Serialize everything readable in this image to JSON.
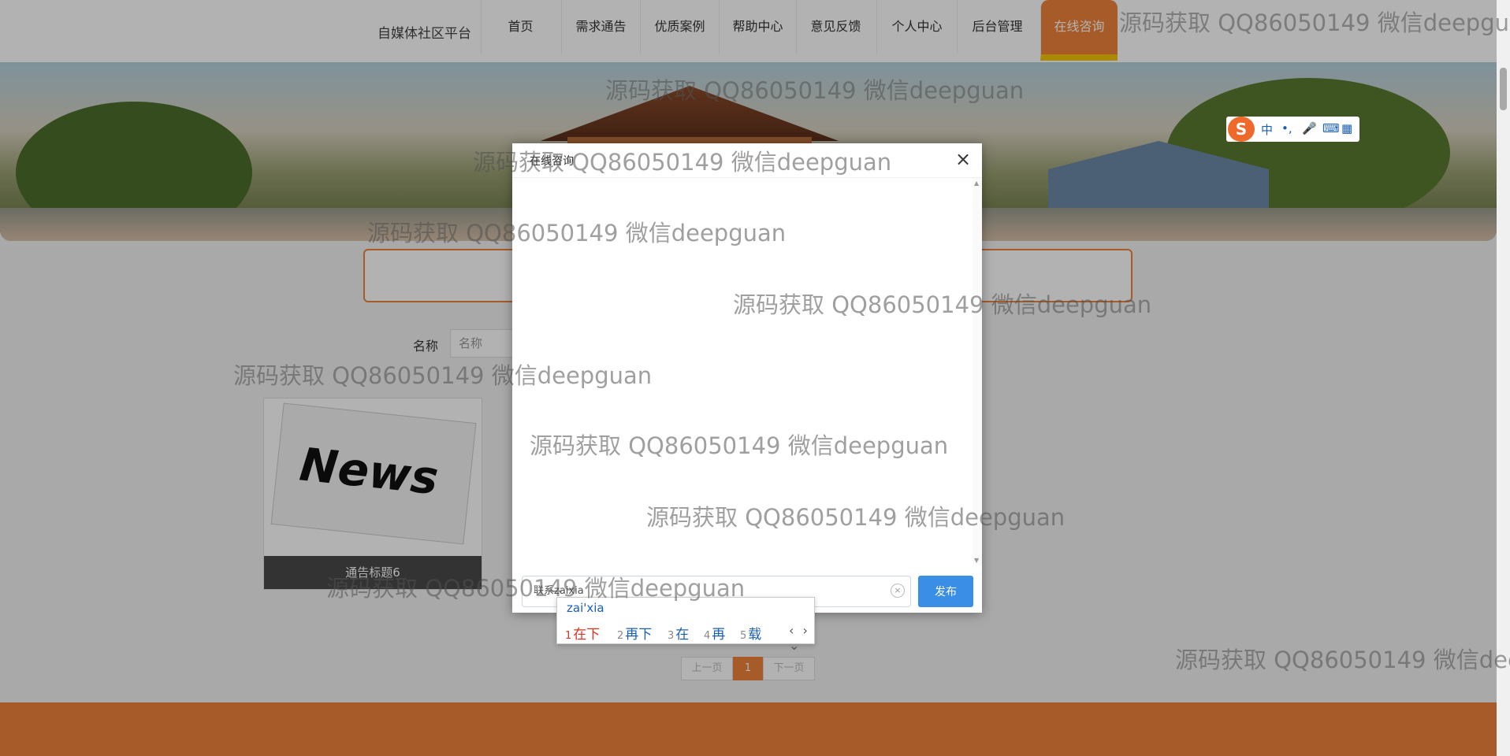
{
  "brand": "自媒体社区平台",
  "nav": [
    {
      "label": "首页"
    },
    {
      "label": "需求通告"
    },
    {
      "label": "优质案例"
    },
    {
      "label": "帮助中心"
    },
    {
      "label": "意见反馈"
    },
    {
      "label": "个人中心"
    },
    {
      "label": "后台管理"
    },
    {
      "label": "在线咨询",
      "active": true
    }
  ],
  "search": {
    "label": "名称",
    "placeholder": "名称"
  },
  "card": {
    "image_text": "News",
    "caption": "通告标题6"
  },
  "pagination": {
    "prev": "上一页",
    "current": "1",
    "next": "下一页"
  },
  "modal": {
    "title": "在线咨询",
    "close": "×",
    "input_value": "联系zaixia",
    "publish": "发布"
  },
  "ime": {
    "pinyin": "zai'xia",
    "candidates": [
      {
        "num": "1",
        "text": "在下"
      },
      {
        "num": "2",
        "text": "再下"
      },
      {
        "num": "3",
        "text": "在"
      },
      {
        "num": "4",
        "text": "再"
      },
      {
        "num": "5",
        "text": "载"
      }
    ],
    "nav": "‹ › ⌄",
    "toolbar": {
      "logo": "S",
      "lang": "中",
      "punct": "•,",
      "mic": "🎤",
      "keyboard": "⌨",
      "grid": "▦"
    }
  },
  "watermark": "源码获取 QQ86050149 微信deepguan",
  "accent_color": "#f0833a",
  "primary_color": "#3a8ee6"
}
